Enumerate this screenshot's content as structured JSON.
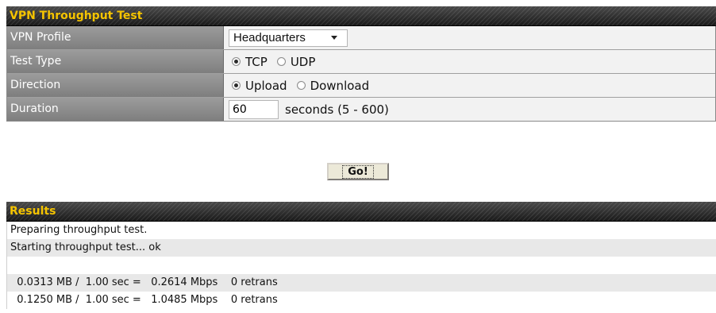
{
  "vpn_panel": {
    "title": "VPN Throughput Test",
    "rows": {
      "profile_label": "VPN Profile",
      "profile_value": "Headquarters",
      "test_type_label": "Test Type",
      "test_type_options": [
        "TCP",
        "UDP"
      ],
      "test_type_selected": "TCP",
      "direction_label": "Direction",
      "direction_options": [
        "Upload",
        "Download"
      ],
      "direction_selected": "Upload",
      "duration_label": "Duration",
      "duration_value": "60",
      "duration_hint": "seconds (5 - 600)"
    },
    "go_label": "Go!"
  },
  "results_panel": {
    "title": "Results",
    "lines": [
      "Preparing throughput test.",
      "Starting throughput test... ok",
      "",
      "  0.0313 MB /  1.00 sec =   0.2614 Mbps    0 retrans",
      "  0.1250 MB /  1.00 sec =   1.0485 Mbps    0 retrans"
    ]
  }
}
